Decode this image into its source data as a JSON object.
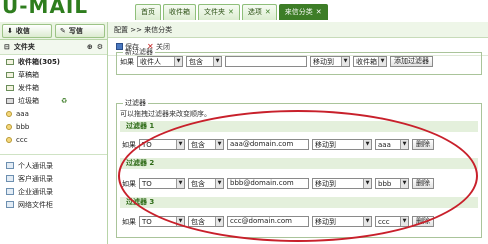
{
  "app": {
    "logo": "U-MAIL"
  },
  "tabs": [
    {
      "label": "首页"
    },
    {
      "label": "收件箱"
    },
    {
      "label": "文件夹"
    },
    {
      "label": "选项"
    },
    {
      "label": "来信分类"
    }
  ],
  "sidebar": {
    "receive_label": "收信",
    "compose_label": "写信",
    "folders_title": "文件夹",
    "folders": [
      {
        "label": "收件箱(305)",
        "icon": "inbox-icon"
      },
      {
        "label": "草稿箱",
        "icon": "drafts-icon"
      },
      {
        "label": "发件箱",
        "icon": "sent-icon"
      },
      {
        "label": "垃圾箱",
        "icon": "trash-icon"
      },
      {
        "label": "aaa",
        "icon": "folder-icon"
      },
      {
        "label": "bbb",
        "icon": "folder-icon"
      },
      {
        "label": "ccc",
        "icon": "folder-icon"
      }
    ],
    "contacts": [
      {
        "label": "个人通讯录"
      },
      {
        "label": "客户通讯录"
      },
      {
        "label": "企业通讯录"
      },
      {
        "label": "网络文件柜"
      }
    ]
  },
  "main": {
    "breadcrumb": "配置 >> 来信分类",
    "save_label": "保存",
    "close_label": "关闭",
    "new_filter": {
      "legend": "新过滤器",
      "if_label": "如果",
      "field": "收件人",
      "op": "包含",
      "value": "",
      "action": "移动到",
      "folder": "收件箱",
      "add_label": "添加过滤器"
    },
    "filters": {
      "legend": "过滤器",
      "hint": "可以拖拽过滤器来改变顺序。",
      "items": [
        {
          "title": "过滤器 1",
          "if_label": "如果",
          "field": "TO",
          "op": "包含",
          "value": "aaa@domain.com",
          "action": "移动到",
          "folder": "aaa",
          "delete_label": "删除"
        },
        {
          "title": "过滤器 2",
          "if_label": "如果",
          "field": "TO",
          "op": "包含",
          "value": "bbb@domain.com",
          "action": "移动到",
          "folder": "bbb",
          "delete_label": "删除"
        },
        {
          "title": "过滤器 3",
          "if_label": "如果",
          "field": "TO",
          "op": "包含",
          "value": "ccc@domain.com",
          "action": "移动到",
          "folder": "ccc",
          "delete_label": "删除"
        }
      ]
    }
  },
  "colors": {
    "brand": "#3d7d27",
    "highlight_oval": "#c8202b"
  }
}
